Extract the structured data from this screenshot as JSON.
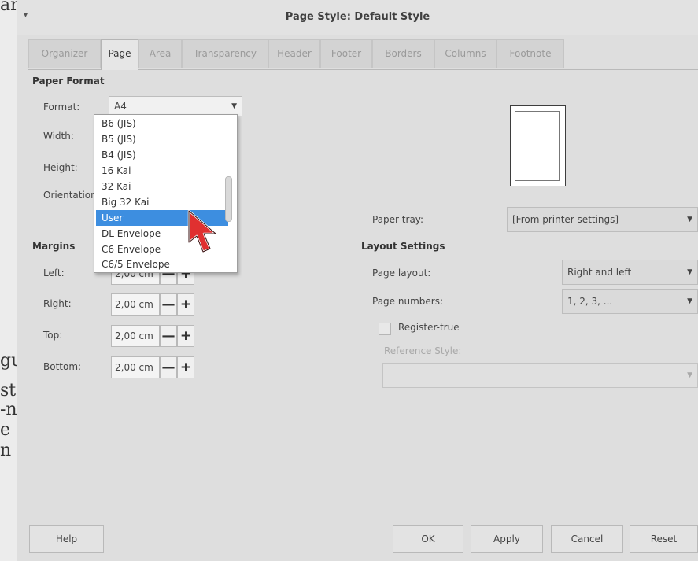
{
  "doc_strip": {
    "glyphs": [
      "ar",
      "gu",
      "st",
      "-n",
      "e",
      "n"
    ]
  },
  "window": {
    "title": "Page Style: Default Style",
    "menu_glyph": "▾"
  },
  "tabs": [
    {
      "label": "Organizer",
      "active": false
    },
    {
      "label": "Page",
      "active": true
    },
    {
      "label": "Area",
      "active": false
    },
    {
      "label": "Transparency",
      "active": false
    },
    {
      "label": "Header",
      "active": false
    },
    {
      "label": "Footer",
      "active": false
    },
    {
      "label": "Borders",
      "active": false
    },
    {
      "label": "Columns",
      "active": false
    },
    {
      "label": "Footnote",
      "active": false
    }
  ],
  "paper_format": {
    "heading": "Paper Format",
    "format_label": "Format:",
    "format_value": "A4",
    "width_label": "Width:",
    "height_label": "Height:",
    "orientation_label": "Orientation:"
  },
  "format_dropdown": {
    "items": [
      "B6 (JIS)",
      "B5 (JIS)",
      "B4 (JIS)",
      "16 Kai",
      "32 Kai",
      "Big 32 Kai",
      "User",
      "DL Envelope",
      "C6 Envelope",
      "C6/5 Envelope"
    ],
    "selected": "User",
    "scroll_position": 0.55
  },
  "margins": {
    "heading": "Margins",
    "left_label": "Left:",
    "left_value": "2,00 cm",
    "right_label": "Right:",
    "right_value": "2,00 cm",
    "top_label": "Top:",
    "top_value": "2,00 cm",
    "bottom_label": "Bottom:",
    "bottom_value": "2,00 cm",
    "minus": "—",
    "plus": "+"
  },
  "paper_tray": {
    "label": "Paper tray:",
    "value": "[From printer settings]"
  },
  "layout_settings": {
    "heading": "Layout Settings",
    "page_layout_label": "Page layout:",
    "page_layout_value": "Right and left",
    "page_numbers_label": "Page numbers:",
    "page_numbers_value": "1, 2, 3, ...",
    "register_true_label": "Register-true",
    "register_true_checked": false,
    "reference_style_label": "Reference Style:",
    "reference_style_value": ""
  },
  "buttons": {
    "help": "Help",
    "ok": "OK",
    "apply": "Apply",
    "cancel": "Cancel",
    "reset": "Reset"
  },
  "colors": {
    "selection": "#3d8ee0",
    "cursor": "#e03030"
  }
}
